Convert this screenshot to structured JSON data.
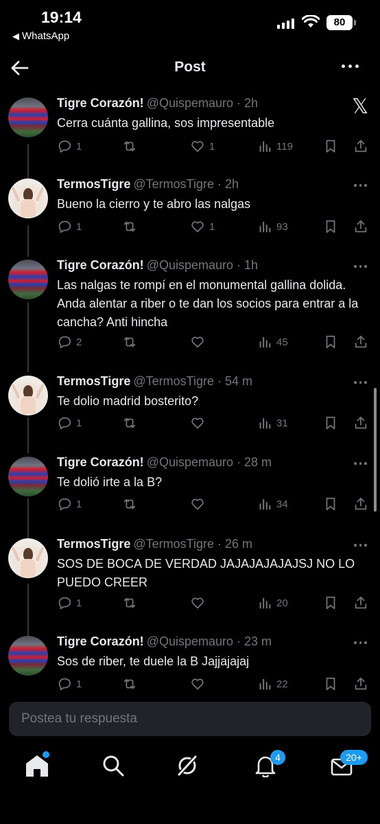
{
  "status_bar": {
    "time": "19:14",
    "back_app": "WhatsApp",
    "battery": "80"
  },
  "header": {
    "title": "Post"
  },
  "tweets": [
    {
      "name": "Tigre Corazón!",
      "handle": "@Quispemauro",
      "time": "· 2h",
      "text": "Cerra cuánta gallina, sos impresentable",
      "replies": "1",
      "retweets": "",
      "likes": "1",
      "views": "119",
      "avatar": "tigre"
    },
    {
      "name": "TermosTigre",
      "handle": "@TermosTigre",
      "time": "· 2h",
      "text": "Bueno la cierro y te abro las nalgas",
      "replies": "1",
      "retweets": "",
      "likes": "1",
      "views": "93",
      "avatar": "termos"
    },
    {
      "name": "Tigre Corazón!",
      "handle": "@Quispemauro",
      "time": "· 1h",
      "text": "Las nalgas te rompí en el monumental gallina dolida. Anda alentar a riber o te dan los socios para entrar a la cancha? Anti hincha",
      "replies": "2",
      "retweets": "",
      "likes": "",
      "views": "45",
      "avatar": "tigre"
    },
    {
      "name": "TermosTigre",
      "handle": "@TermosTigre",
      "time": "· 54 m",
      "text": "Te dolio madrid bosterito?",
      "replies": "1",
      "retweets": "",
      "likes": "",
      "views": "31",
      "avatar": "termos"
    },
    {
      "name": "Tigre Corazón!",
      "handle": "@Quispemauro",
      "time": "· 28 m",
      "text": "Te dolió irte a la B?",
      "replies": "1",
      "retweets": "",
      "likes": "",
      "views": "34",
      "avatar": "tigre"
    },
    {
      "name": "TermosTigre",
      "handle": "@TermosTigre",
      "time": "· 26 m",
      "text": "SOS DE BOCA DE VERDAD JAJAJAJAJAJSJ NO LO PUEDO CREER",
      "replies": "1",
      "retweets": "",
      "likes": "",
      "views": "20",
      "avatar": "termos"
    },
    {
      "name": "Tigre Corazón!",
      "handle": "@Quispemauro",
      "time": "· 23 m",
      "text": "Sos de riber, te duele la B Jajjajajaj",
      "replies": "1",
      "retweets": "",
      "likes": "",
      "views": "22",
      "avatar": "tigre"
    }
  ],
  "reply_box": {
    "placeholder": "Postea tu respuesta"
  },
  "tab_bar": {
    "notifications_badge": "4",
    "messages_badge": "20+"
  },
  "icons": [
    "back-arrow-icon",
    "more-icon",
    "x-logo-icon",
    "reply-icon",
    "retweet-icon",
    "like-icon",
    "views-icon",
    "bookmark-icon",
    "share-icon",
    "home-icon",
    "search-icon",
    "grok-icon",
    "bell-icon",
    "mail-icon"
  ],
  "colors": {
    "background": "#000000",
    "text": "#e7e9ea",
    "muted": "#71767b",
    "accent": "#1d9bf0"
  }
}
